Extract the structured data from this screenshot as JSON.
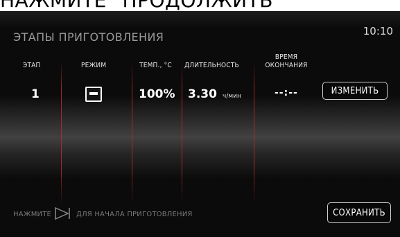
{
  "caption": "НАЖМИТЕ \"ПРОДОЛЖИТЬ\"",
  "screen": {
    "title": "ЭТАПЫ ПРИГОТОВЛЕНИЯ",
    "clock": "10:10",
    "columns": {
      "stage": "ЭТАП",
      "mode": "РЕЖИМ",
      "temp": "ТЕМП., °C",
      "duration": "ДЛИТЕЛЬНОСТЬ",
      "end_time_line1": "ВРЕМЯ",
      "end_time_line2": "ОКОНЧАНИЯ"
    },
    "row": {
      "stage": "1",
      "mode_icon": "mode-grill-icon",
      "temp": "100%",
      "duration_value": "3.30",
      "duration_unit": "ч/мин",
      "end_time": "--:--"
    },
    "buttons": {
      "change": "ИЗМЕНИТЬ",
      "save": "СОХРАНИТЬ"
    },
    "hint": {
      "prefix": "НАЖМИТЕ",
      "icon": "play-icon",
      "suffix": "ДЛЯ НАЧАЛА ПРИГОТОВЛЕНИЯ"
    }
  },
  "colors": {
    "background": "#0b0b0b",
    "divider": "#be2828",
    "text": "#ffffff",
    "muted": "#7a7a7a"
  }
}
